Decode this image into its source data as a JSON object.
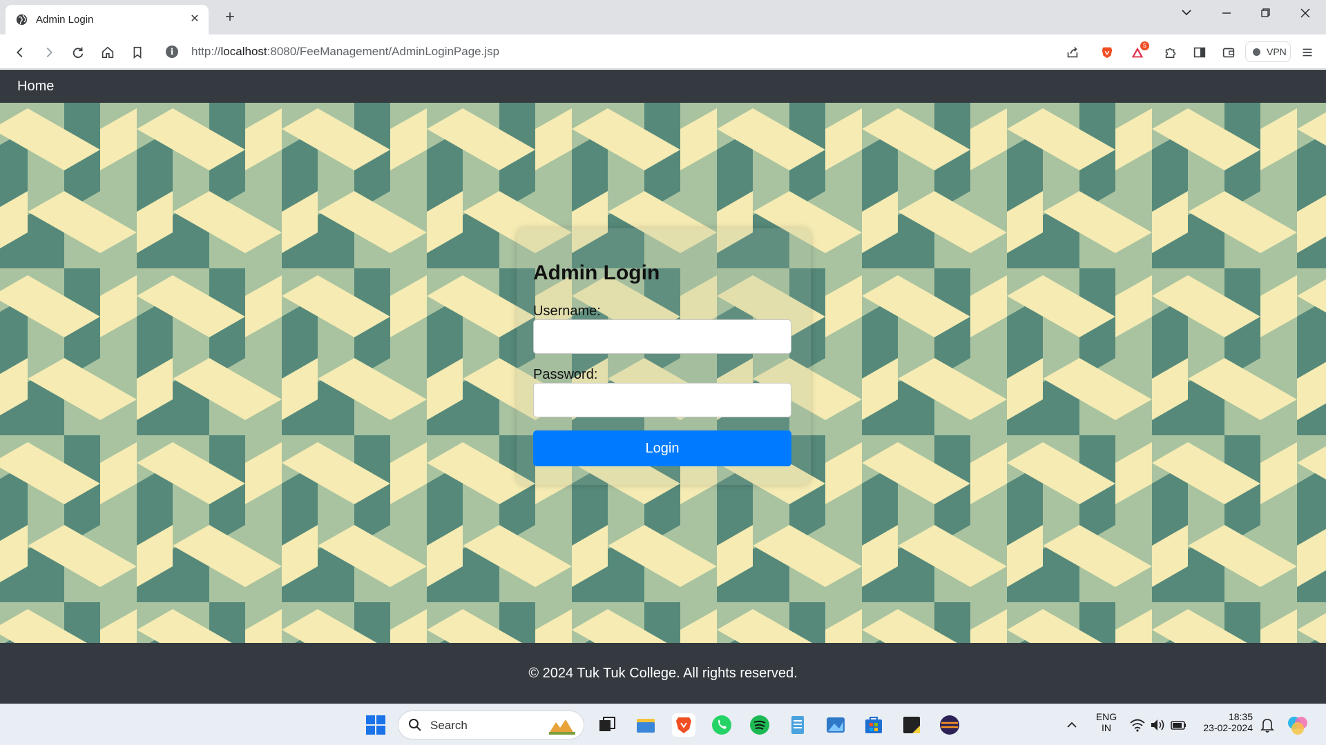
{
  "browser": {
    "tab_title": "Admin Login",
    "tab_close": "✕",
    "new_tab": "+",
    "url_prefix": "http://",
    "url_host": "localhost",
    "url_rest": ":8080/FeeManagement/AdminLoginPage.jsp",
    "vpn_label": "VPN",
    "notification_count": "5"
  },
  "page": {
    "nav_home": "Home",
    "login_title": "Admin Login",
    "username_label": "Username:",
    "username_value": "",
    "password_label": "Password:",
    "password_value": "",
    "login_button": "Login",
    "footer_text": "© 2024 Tuk Tuk College. All rights reserved."
  },
  "taskbar": {
    "search_placeholder": "Search",
    "lang_top": "ENG",
    "lang_bottom": "IN",
    "time": "18:35",
    "date": "23-02-2024"
  },
  "colors": {
    "navbar": "#343a40",
    "button": "#007bff",
    "pattern_yellow": "#f5ebb3",
    "pattern_dark": "#56897a",
    "pattern_light": "#a9c3a0"
  }
}
